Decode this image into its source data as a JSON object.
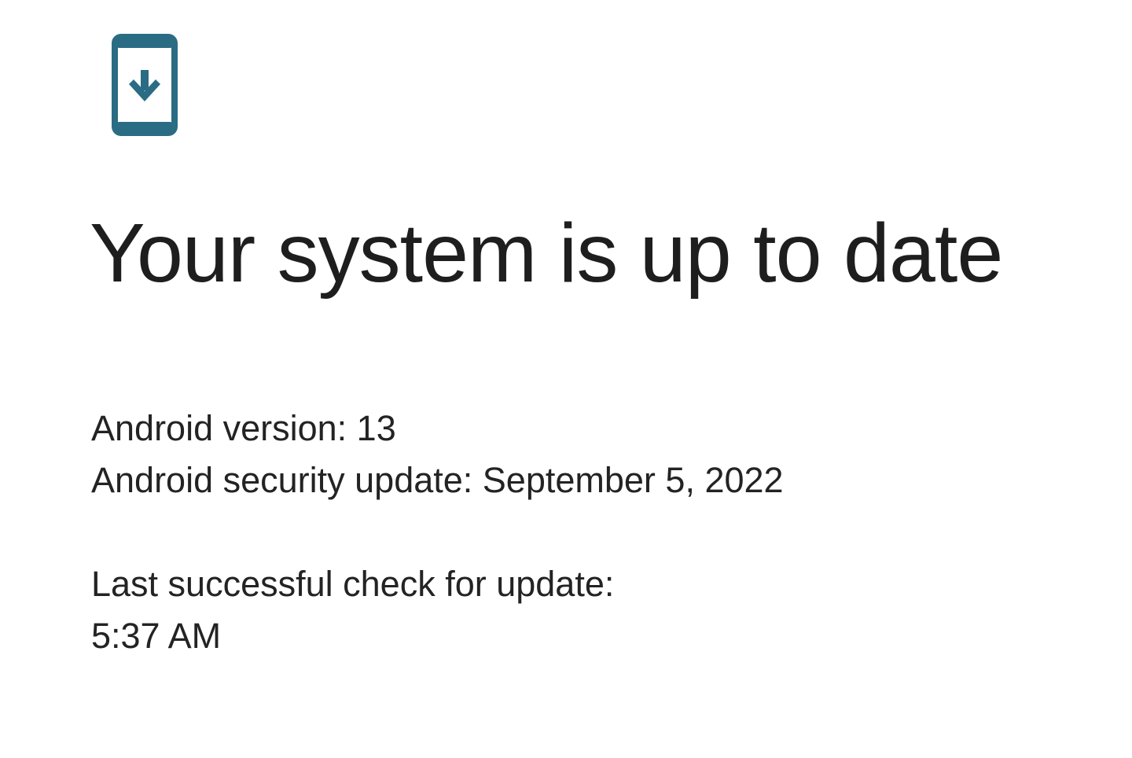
{
  "icon": {
    "name": "system-update-icon",
    "color": "#2a6c84"
  },
  "status": {
    "title": "Your system is up to date"
  },
  "versions": {
    "android_version": "Android version: 13",
    "security_update": "Android security update: September 5, 2022"
  },
  "last_check": {
    "label": "Last successful check for update:",
    "time": "5:37 AM"
  }
}
